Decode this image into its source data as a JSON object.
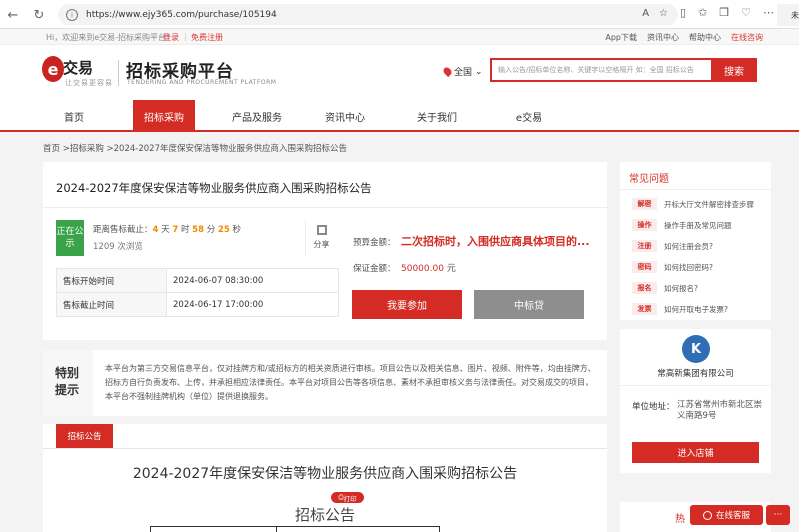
{
  "browser": {
    "url": "https://www.ejy365.com/purchase/105194",
    "end_text": "未"
  },
  "topbar": {
    "greeting": "Hi，欢迎来到e交易-招标采购平台！",
    "login": "登录",
    "sep": "|",
    "register": "免费注册",
    "links": [
      "App下载",
      "资讯中心",
      "帮助中心"
    ],
    "consult": "在线咨询"
  },
  "header": {
    "logo_mark": "e",
    "logo_main": "交易",
    "logo_sub": "让交易更容易",
    "platform_title": "招标采购平台",
    "platform_sub": "TENDERING AND PROCUREMENT PLATFORM",
    "region": "全国",
    "search_placeholder": "输入公告/招标单位名称、关键字以空格隔开 如：全国 招标公告",
    "search_btn": "搜索"
  },
  "nav": {
    "items": [
      "首页",
      "招标采购",
      "产品及服务",
      "资讯中心",
      "关于我们",
      "e交易"
    ]
  },
  "breadcrumb": "首页 >招标采购 >2024-2027年度保安保洁等物业服务供应商入围采购招标公告",
  "main": {
    "title": "2024-2027年度保安保洁等物业服务供应商入围采购招标公告",
    "status": "正在公示",
    "countdown_label": "距离售标截止：",
    "days": "4",
    "days_unit": " 天 ",
    "hours": "7",
    "hours_unit": " 时 ",
    "minutes": "58",
    "minutes_unit": " 分 ",
    "seconds": "25",
    "seconds_unit": " 秒",
    "views": "1209 次浏览",
    "share": "分享",
    "rows": [
      {
        "k": "售标开始时间",
        "v": "2024-06-07 08:30:00"
      },
      {
        "k": "售标截止时间",
        "v": "2024-06-17 17:00:00"
      }
    ],
    "budget_label": "预算金额：",
    "budget_val": "二次招标时，入围供应商具体项目的...",
    "deposit_label": "保证金额：",
    "deposit_val": "50000.00",
    "deposit_unit": " 元",
    "join_btn": "我要参加",
    "loan_btn": "中标贷"
  },
  "notice": {
    "label_line1": "特别",
    "label_line2": "提示",
    "text": "本平台为第三方交易信息平台，仅对挂牌方和/或招标方的相关资质进行审核。项目公告以及相关信息、图片、视频、附件等，均由挂牌方、招标方自行负责发布、上传，并承担相应法律责任。本平台对项目公告等各项信息、素材不承担审核义务与法律责任。对交易成交的项目，本平台不强制挂牌机构（单位）提供退换服务。"
  },
  "doc": {
    "tab": "招标公告",
    "title": "2024-2027年度保安保洁等物业服务供应商入围采购招标公告",
    "print": "打印",
    "subtitle": "招标公告"
  },
  "faq": {
    "title": "常见问题",
    "items": [
      {
        "tag": "解密",
        "text": "开标大厅文件解密排查步骤"
      },
      {
        "tag": "操作",
        "text": "操作手册及常见问题"
      },
      {
        "tag": "注册",
        "text": "如何注册会员?"
      },
      {
        "tag": "密码",
        "text": "如何找回密码?"
      },
      {
        "tag": "报名",
        "text": "如何报名?"
      },
      {
        "tag": "发票",
        "text": "如何开取电子发票?"
      }
    ]
  },
  "company": {
    "name": "常高新集团有限公司",
    "addr_label": "单位地址：",
    "addr_val": "江苏省常州市新北区崇义南路9号",
    "shop_btn": "进入店铺"
  },
  "hot": {
    "title": "热"
  },
  "float": {
    "cs": "在线客服",
    "dots": "···"
  },
  "colors": {
    "brand": "#d42c24",
    "status": "#3aa34a",
    "countdown": "#f08a00"
  }
}
